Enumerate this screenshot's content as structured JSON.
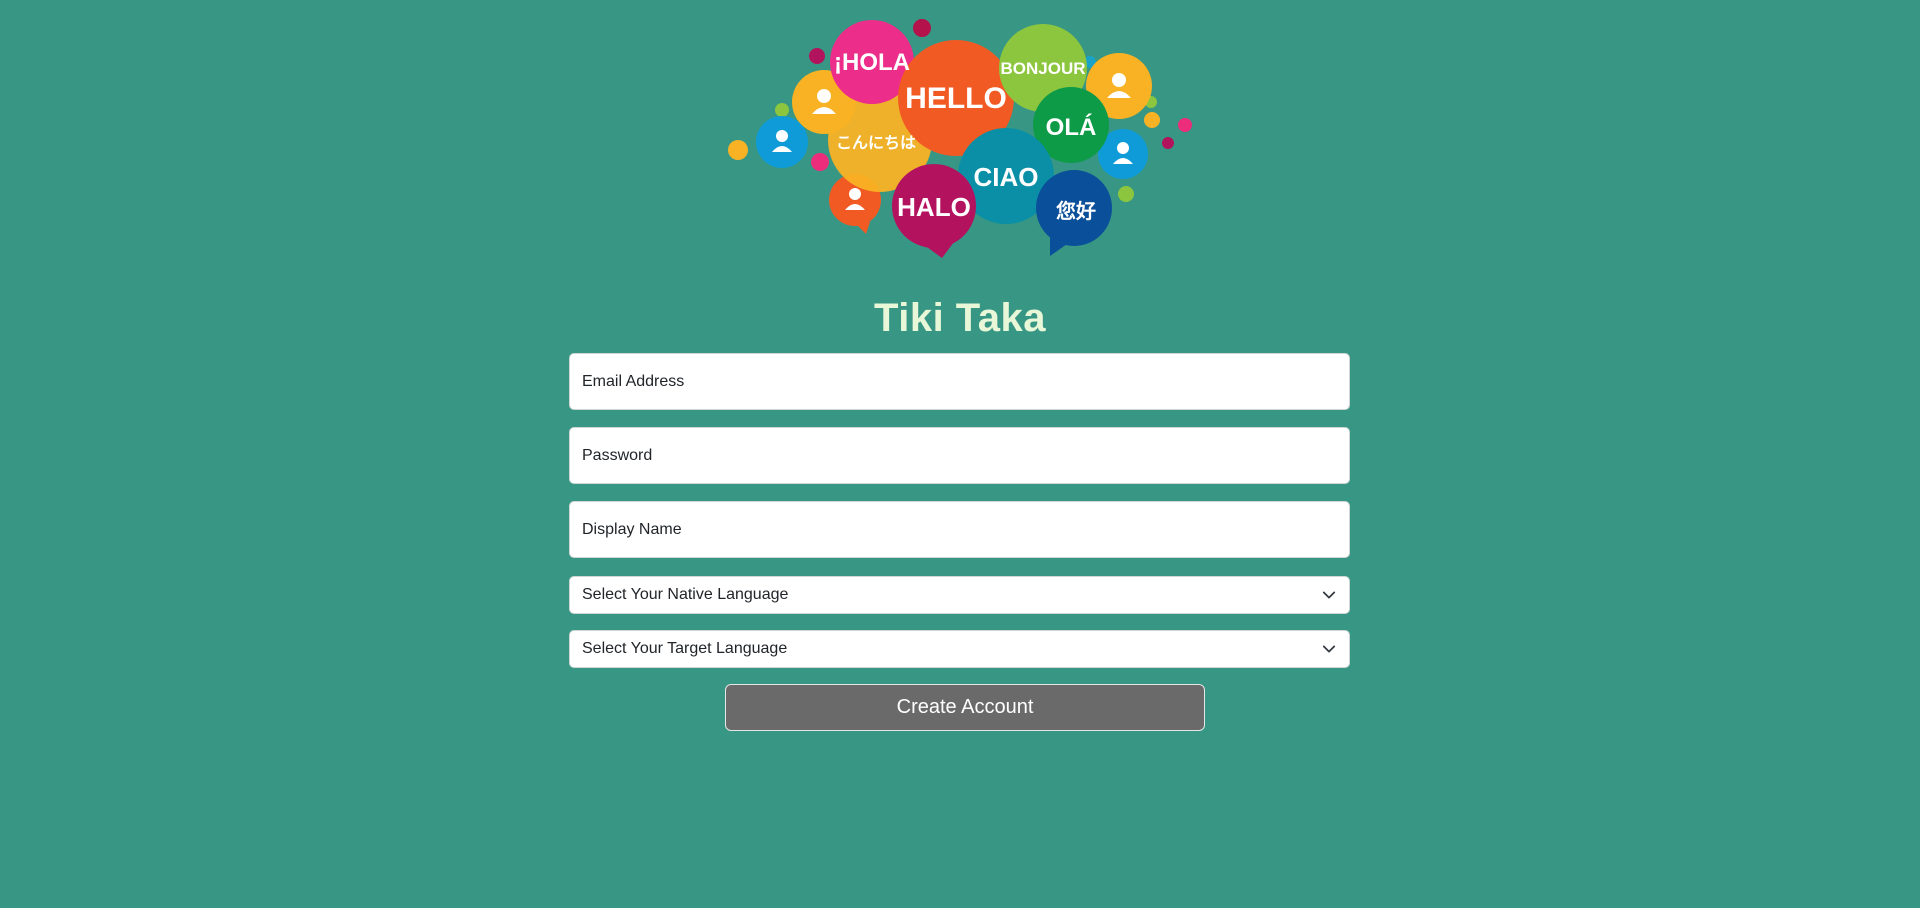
{
  "logo": {
    "greetings": [
      "¡HOLA",
      "HELLO",
      "BONJOUR",
      "OLÁ",
      "こんにちは",
      "CIAO",
      "HALO",
      "您好"
    ]
  },
  "title": "Tiki Taka",
  "form": {
    "email_placeholder": "Email Address",
    "password_placeholder": "Password",
    "display_name_placeholder": "Display Name",
    "native_language_label": "Select Your Native Language",
    "target_language_label": "Select Your Target Language",
    "submit_label": "Create Account"
  },
  "colors": {
    "background": "#389684",
    "title": "#e8f7d8",
    "button": "#6a6a6a"
  }
}
